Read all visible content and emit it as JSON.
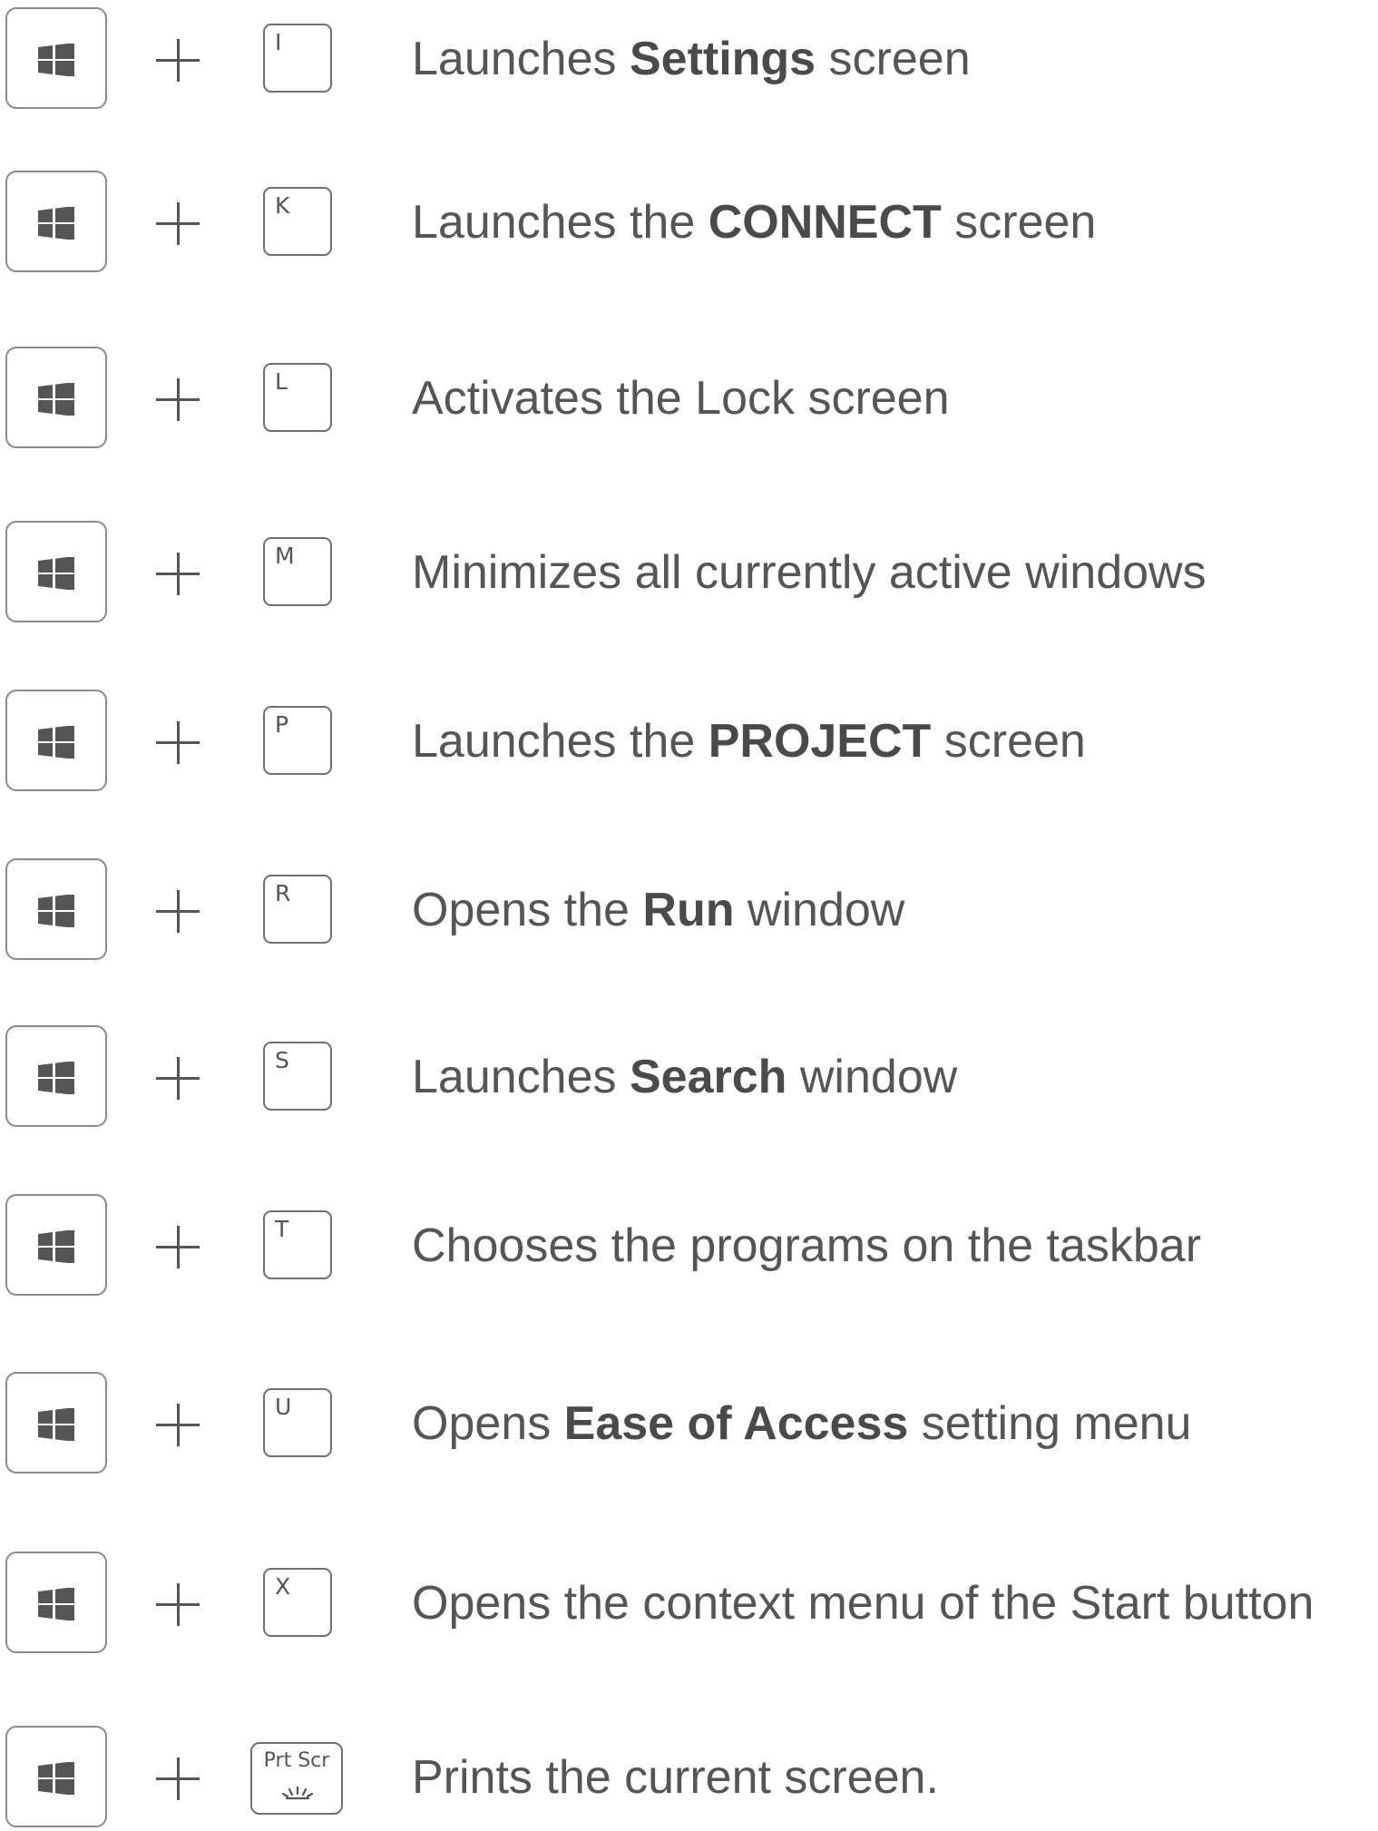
{
  "shortcuts": [
    {
      "key": "I",
      "desc_pre": "Launches ",
      "desc_bold": "Settings",
      "desc_post": " screen"
    },
    {
      "key": "K",
      "desc_pre": "Launches the ",
      "desc_bold": "CONNECT",
      "desc_post": " screen"
    },
    {
      "key": "L",
      "desc_pre": "Activates the Lock screen",
      "desc_bold": "",
      "desc_post": ""
    },
    {
      "key": "M",
      "desc_pre": "Minimizes all currently active windows",
      "desc_bold": "",
      "desc_post": ""
    },
    {
      "key": "P",
      "desc_pre": "Launches the ",
      "desc_bold": "PROJECT",
      "desc_post": " screen"
    },
    {
      "key": "R",
      "desc_pre": "Opens the ",
      "desc_bold": "Run",
      "desc_post": " window"
    },
    {
      "key": "S",
      "desc_pre": "Launches ",
      "desc_bold": "Search",
      "desc_post": " window"
    },
    {
      "key": "T",
      "desc_pre": "Chooses the programs on the taskbar",
      "desc_bold": "",
      "desc_post": ""
    },
    {
      "key": "U",
      "desc_pre": "Opens ",
      "desc_bold": "Ease of Access",
      "desc_post": " setting menu"
    },
    {
      "key": "X",
      "desc_pre": "Opens the context menu of the Start button",
      "desc_bold": "",
      "desc_post": ""
    },
    {
      "key": "Prt Scr",
      "desc_pre": "Prints the current screen.",
      "desc_bold": "",
      "desc_post": ""
    }
  ],
  "icons": {
    "windows_key": "windows-logo-icon",
    "plus": "plus-icon",
    "print_screen": "screen-flash-icon"
  },
  "colors": {
    "text": "#555555",
    "key_border": "#8a8a8a"
  }
}
